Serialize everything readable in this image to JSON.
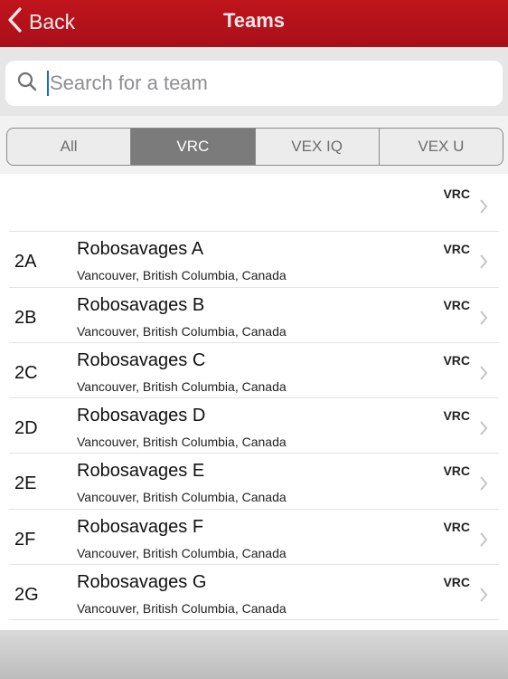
{
  "navbar": {
    "back_label": "Back",
    "title": "Teams",
    "color": "#b3121b"
  },
  "search": {
    "placeholder": "Search for a team",
    "value": ""
  },
  "segments": [
    {
      "label": "All",
      "active": false
    },
    {
      "label": "VRC",
      "active": true
    },
    {
      "label": "VEX IQ",
      "active": false
    },
    {
      "label": "VEX U",
      "active": false
    }
  ],
  "teams": [
    {
      "number": "",
      "name": "",
      "location": "",
      "program": "VRC"
    },
    {
      "number": "2A",
      "name": "Robosavages A",
      "location": "Vancouver, British Columbia, Canada",
      "program": "VRC"
    },
    {
      "number": "2B",
      "name": "Robosavages B",
      "location": "Vancouver, British Columbia, Canada",
      "program": "VRC"
    },
    {
      "number": "2C",
      "name": "Robosavages C",
      "location": "Vancouver, British Columbia, Canada",
      "program": "VRC"
    },
    {
      "number": "2D",
      "name": "Robosavages D",
      "location": "Vancouver, British Columbia, Canada",
      "program": "VRC"
    },
    {
      "number": "2E",
      "name": "Robosavages E",
      "location": "Vancouver, British Columbia, Canada",
      "program": "VRC"
    },
    {
      "number": "2F",
      "name": "Robosavages F",
      "location": "Vancouver, British Columbia, Canada",
      "program": "VRC"
    },
    {
      "number": "2G",
      "name": "Robosavages G",
      "location": "Vancouver, British Columbia, Canada",
      "program": "VRC"
    }
  ],
  "icons": {
    "back": "chevron-left-icon",
    "search": "search-icon",
    "row": "chevron-right-icon"
  }
}
